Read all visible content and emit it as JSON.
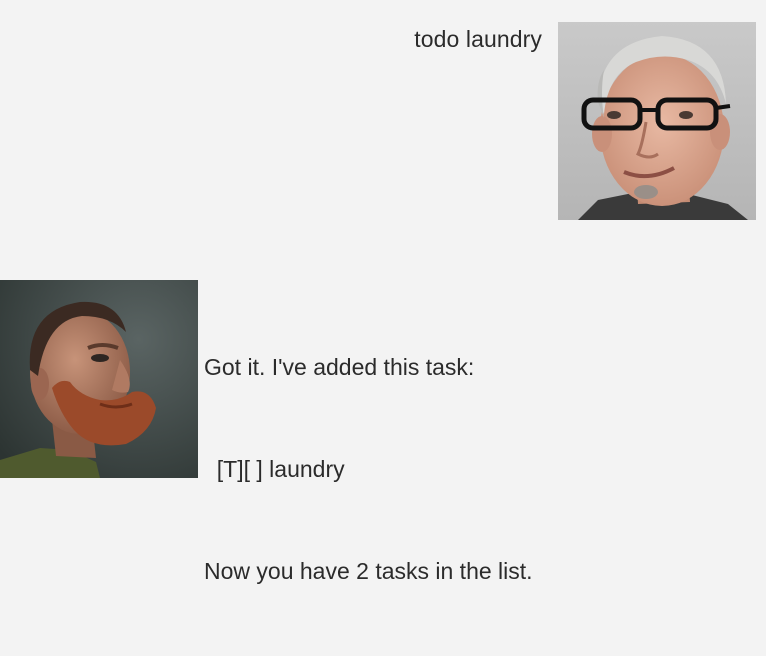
{
  "conversation": {
    "user_message": {
      "text": "todo laundry",
      "avatar_icon": "user-avatar-glasses-man"
    },
    "bot_message": {
      "lines": [
        "Got it. I've added this task:",
        "  [T][ ] laundry",
        "Now you have 2 tasks in the list."
      ],
      "avatar_icon": "bot-avatar-bearded-man"
    }
  },
  "colors": {
    "background": "#f3f3f3",
    "text": "#2b2b2b"
  }
}
